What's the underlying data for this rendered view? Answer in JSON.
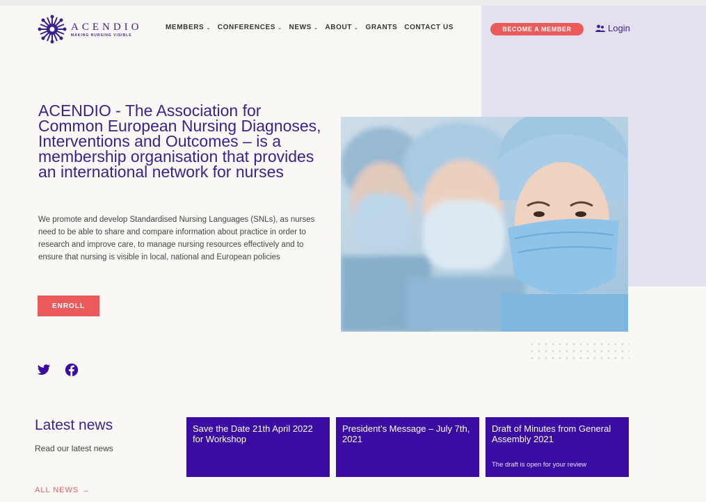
{
  "header": {
    "logo": {
      "name": "ACENDIO",
      "tagline": "MAKING NURSING VISIBLE"
    },
    "nav": [
      {
        "label": "MEMBERS",
        "has_dropdown": true
      },
      {
        "label": "CONFERENCES",
        "has_dropdown": true
      },
      {
        "label": "NEWS",
        "has_dropdown": true
      },
      {
        "label": "ABOUT",
        "has_dropdown": true
      },
      {
        "label": "GRANTS",
        "has_dropdown": false
      },
      {
        "label": "CONTACT US",
        "has_dropdown": false
      }
    ],
    "cta": "BECOME A MEMBER",
    "login": "Login"
  },
  "hero": {
    "title": "ACENDIO - The Association for Common European Nursing Diagnoses, Interventions and Outcomes – is a membership organisation that provides an international network for nurses",
    "description": "We promote and develop Standardised Nursing Languages (SNLs), as nurses need to be able to share and compare information about practice in order to research and improve care, to manage nursing resources effectively and to ensure that nursing is visible in local, national and European policies",
    "enroll": "ENROLL"
  },
  "social": {
    "icons": [
      "twitter-icon",
      "facebook-icon"
    ]
  },
  "news": {
    "title": "Latest news",
    "subtitle": "Read our latest news",
    "all_news": "ALL NEWS →",
    "cards": [
      {
        "title": "Save the Date 21th April 2022 for Workshop",
        "desc": ""
      },
      {
        "title": "President’s Message – July 7th, 2021",
        "desc": ""
      },
      {
        "title": "Draft of Minutes from General Assembly 2021",
        "desc": "The draft is open for your review"
      }
    ]
  },
  "colors": {
    "brand_purple": "#3a1f8f",
    "card_purple": "#3a0ca3",
    "accent_coral": "#ec5b5b",
    "lavender_panel": "#e5e0ee",
    "background": "#f9f8f5"
  }
}
